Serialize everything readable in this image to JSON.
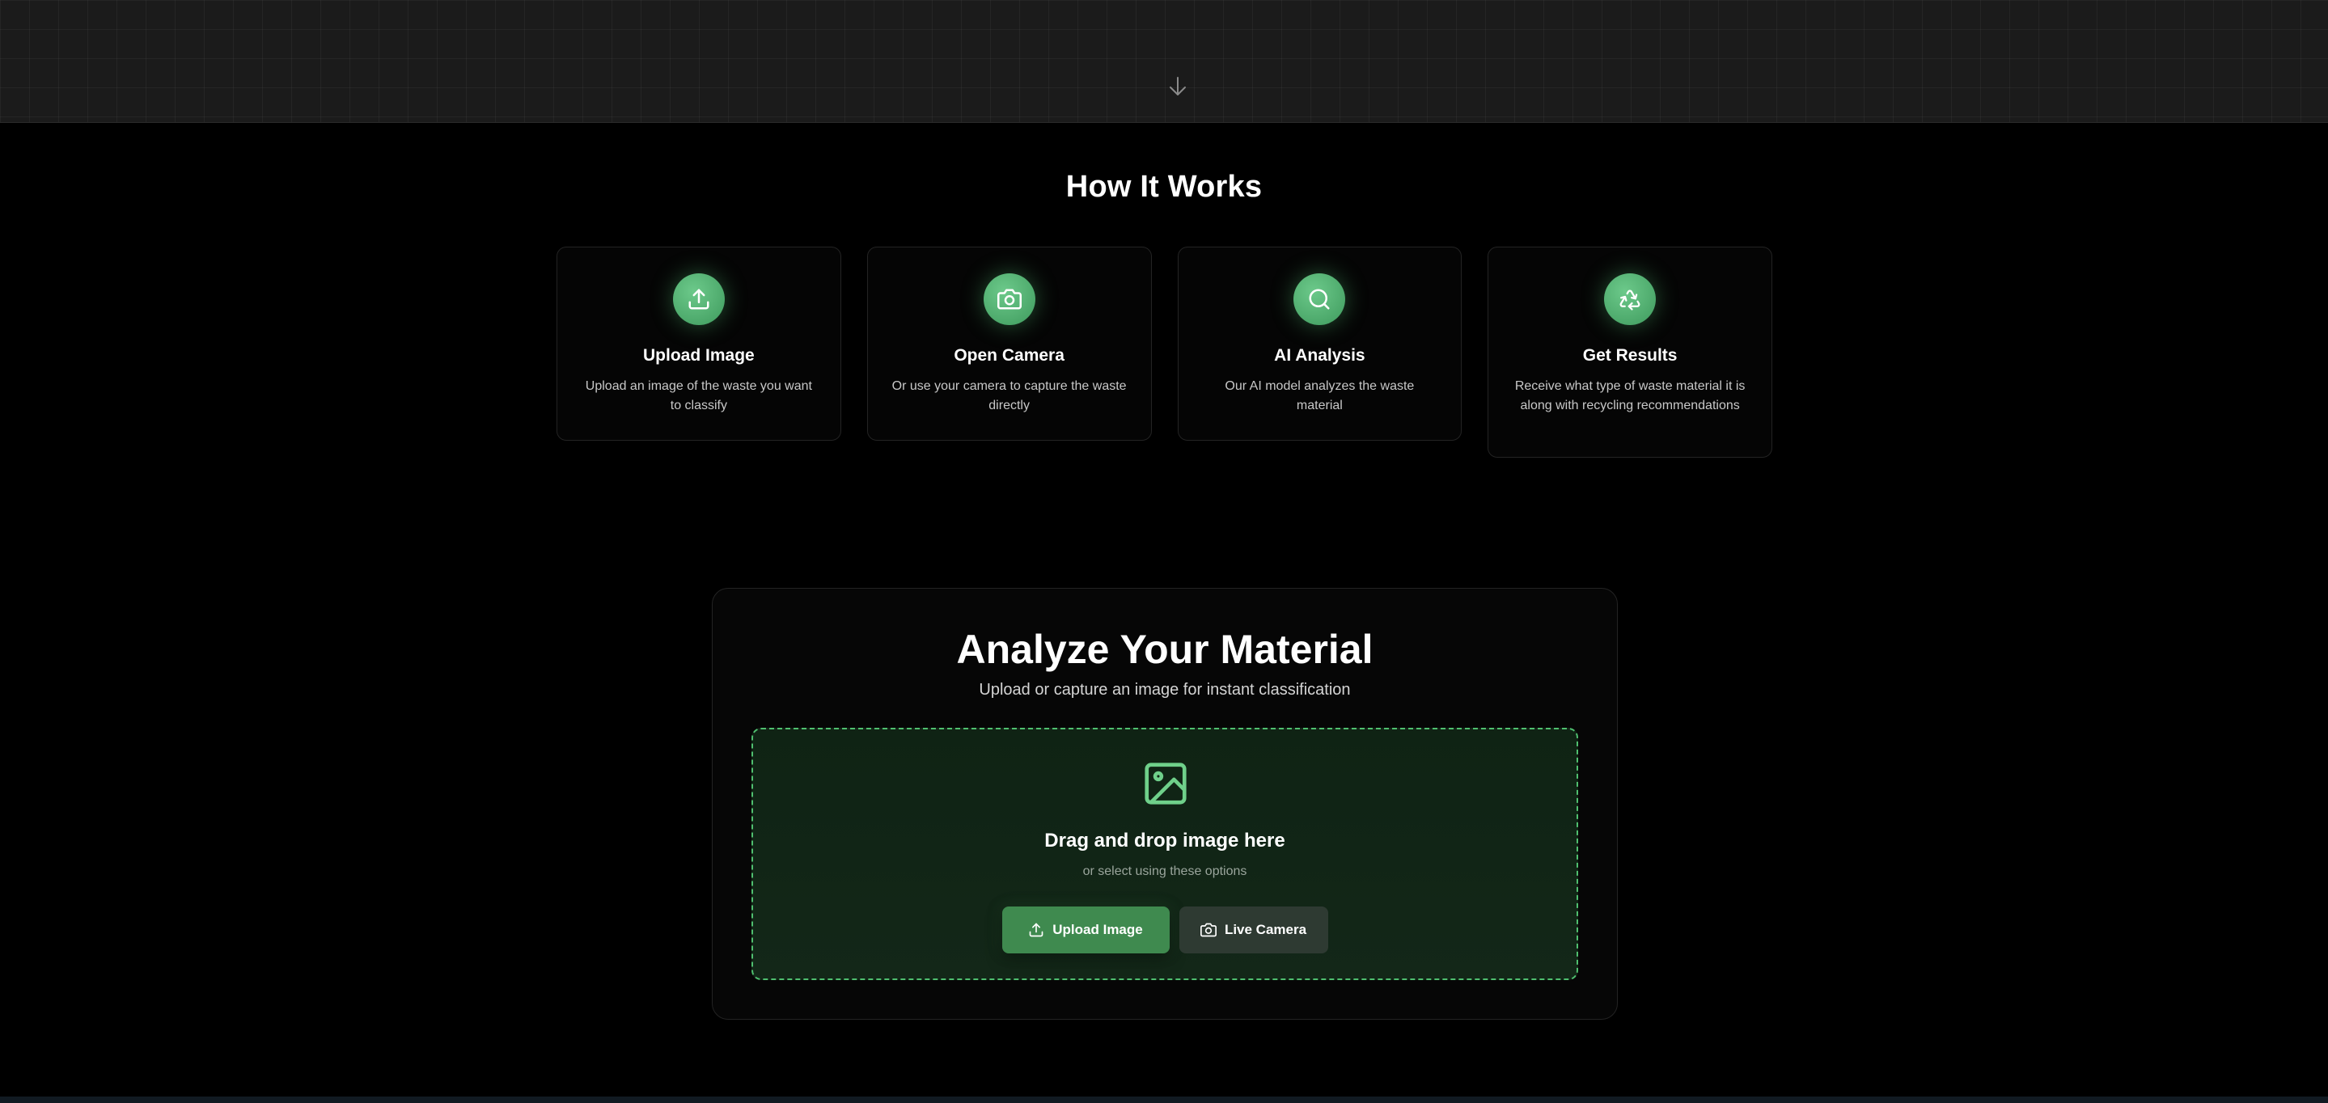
{
  "hero": {
    "scroll_icon": "arrow-down-icon"
  },
  "how_it_works": {
    "title": "How It Works",
    "steps": [
      {
        "icon": "upload-icon",
        "title": "Upload Image",
        "description": "Upload an image of the waste you want to classify"
      },
      {
        "icon": "camera-icon",
        "title": "Open Camera",
        "description": "Or use your camera to capture the waste directly"
      },
      {
        "icon": "search-icon",
        "title": "AI Analysis",
        "description": "Our AI model analyzes the waste material"
      },
      {
        "icon": "recycle-icon",
        "title": "Get Results",
        "description": "Receive what type of waste material it is along with recycling recommendations"
      }
    ]
  },
  "analyze": {
    "title": "Analyze Your Material",
    "subtitle": "Upload or capture an image for instant classification",
    "dropzone": {
      "icon": "image-icon",
      "title": "Drag and drop image here",
      "subtitle": "or select using these options"
    },
    "upload_button": {
      "label": "Upload Image",
      "icon": "upload-icon"
    },
    "camera_button": {
      "label": "Live Camera",
      "icon": "camera-icon"
    }
  },
  "colors": {
    "accent": "#4caf6a",
    "accent_dark": "#3f8a4f",
    "dropzone_border": "#4fbf6f",
    "background": "#000000"
  }
}
